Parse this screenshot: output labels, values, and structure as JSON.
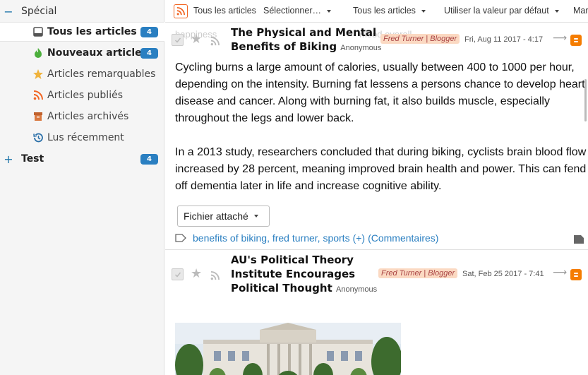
{
  "sidebar": {
    "special": {
      "label": "Spécial",
      "toggle": "−"
    },
    "feeds": [
      {
        "label": "Tous les articles",
        "icon": "archive-tray-icon",
        "count": "4",
        "bold": true,
        "selected": true
      },
      {
        "label": "Nouveaux articles",
        "icon": "fire-icon",
        "count": "4",
        "bold": true
      },
      {
        "label": "Articles remarquables",
        "icon": "star-icon"
      },
      {
        "label": "Articles publiés",
        "icon": "rss-icon"
      },
      {
        "label": "Articles archivés",
        "icon": "archive-box-icon"
      },
      {
        "label": "Lus récemment",
        "icon": "history-icon"
      }
    ],
    "test": {
      "label": "Test",
      "toggle": "+",
      "count": "4"
    }
  },
  "toolbar": {
    "feed_title": "Tous les articles",
    "select_menu": "Sélectionner…",
    "view_mode": "Tous les articles",
    "order": "Utiliser la valeur par défaut",
    "more": "Mar"
  },
  "articles": [
    {
      "title_line1": "The Physical and Mental",
      "title_line2": "Benefits of Biking",
      "author": "Anonymous",
      "source": "Fred Turner | Blogger",
      "date": "Fri, Aug 11 2017 - 4:17",
      "ghost_left": "happiness",
      "ghost_right": "mood overall",
      "body_p1": "Cycling burns a large amount of calories, usually between 400 to 1000 per hour, depending on the intensity. Burning fat lessens a persons chance to develop heart disease and cancer. Along with burning fat, it also builds muscle, especially throughout the legs and lower back.",
      "body_p2": "In a 2013 study, researchers concluded that during biking, cyclists brain blood flow increased by 28 percent, meaning improved brain health and power. This can fend off dementia later in life and increase cognitive ability.",
      "attachment_label": "Fichier attaché",
      "tags": "benefits of biking, fred turner, sports",
      "tags_more": "(+)",
      "comments": "(Commentaires)"
    },
    {
      "title_line1": "AU's Political Theory",
      "title_line2": "Institute Encourages",
      "title_line3": "Political Thought",
      "author": "Anonymous",
      "source": "Fred Turner | Blogger",
      "date": "Sat, Feb 25 2017 - 7:41"
    }
  ],
  "colors": {
    "badge": "#2a7fc1",
    "link": "#2a7fc1",
    "source_bg": "#fbd9c2",
    "blogger": "#f57d00",
    "rss": "#f26522"
  }
}
